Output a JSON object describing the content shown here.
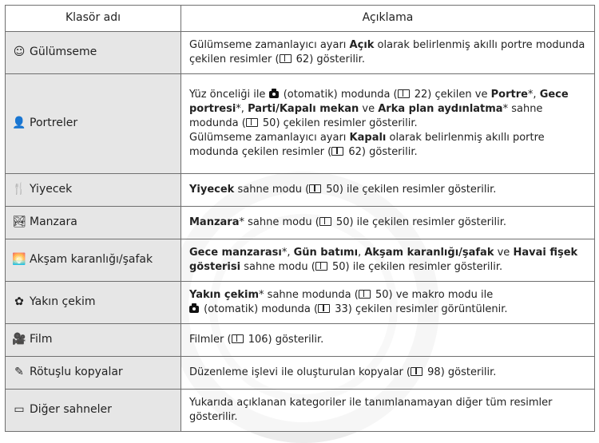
{
  "header": {
    "col_name": "Klasör adı",
    "col_desc": "Açıklama"
  },
  "rows": [
    {
      "icon": "smile-timer-icon",
      "glyph": "☺",
      "name": "Gülümseme",
      "parts": [
        {
          "t": "Gülümseme zamanlayıcı ayarı "
        },
        {
          "t": "Açık",
          "b": true
        },
        {
          "t": " olarak belirlenmiş akıllı portre modunda çekilen resimler ("
        },
        {
          "ref": "book"
        },
        {
          "t": " 62) gösterilir."
        }
      ]
    },
    {
      "icon": "portrait-icon",
      "glyph": "👤",
      "name": "Portreler",
      "parts": [
        {
          "t": "Yüz önceliği ile "
        },
        {
          "ref": "camera"
        },
        {
          "t": " (otomatik) modunda ("
        },
        {
          "ref": "book"
        },
        {
          "t": " 22) çekilen ve "
        },
        {
          "t": "Portre",
          "b": true
        },
        {
          "t": "*, "
        },
        {
          "t": "Gece portresi",
          "b": true
        },
        {
          "t": "*, "
        },
        {
          "t": "Parti/Kapalı mekan",
          "b": true
        },
        {
          "t": " ve "
        },
        {
          "t": "Arka plan aydınlatma",
          "b": true
        },
        {
          "t": "* sahne modunda ("
        },
        {
          "ref": "book"
        },
        {
          "t": " 50) çekilen resimler gösterilir."
        },
        {
          "br": true
        },
        {
          "t": "Gülümseme zamanlayıcı ayarı "
        },
        {
          "t": "Kapalı",
          "b": true
        },
        {
          "t": " olarak belirlenmiş akıllı portre modunda çekilen resimler ("
        },
        {
          "ref": "book"
        },
        {
          "t": " 62) gösterilir."
        }
      ]
    },
    {
      "icon": "food-icon",
      "glyph": "🍴",
      "name": "Yiyecek",
      "parts": [
        {
          "t": "Yiyecek",
          "b": true
        },
        {
          "t": " sahne modu ("
        },
        {
          "ref": "book"
        },
        {
          "t": " 50) ile çekilen resimler gösterilir."
        }
      ]
    },
    {
      "icon": "landscape-icon",
      "glyph": "🏞",
      "name": "Manzara",
      "parts": [
        {
          "t": "Manzara",
          "b": true
        },
        {
          "t": "* sahne modu ("
        },
        {
          "ref": "book"
        },
        {
          "t": " 50) ile çekilen resimler gösterilir."
        }
      ]
    },
    {
      "icon": "dusk-dawn-icon",
      "glyph": "🌅",
      "name": "Akşam karanlığı/şafak",
      "parts": [
        {
          "t": "Gece manzarası",
          "b": true
        },
        {
          "t": "*, "
        },
        {
          "t": "Gün batımı",
          "b": true
        },
        {
          "t": ", "
        },
        {
          "t": "Akşam karanlığı/şafak",
          "b": true
        },
        {
          "t": " ve "
        },
        {
          "t": "Havai fişek gösterisi",
          "b": true
        },
        {
          "t": " sahne modu ("
        },
        {
          "ref": "book"
        },
        {
          "t": " 50) ile çekilen resimler gösterilir."
        }
      ]
    },
    {
      "icon": "close-up-icon",
      "glyph": "✿",
      "name": "Yakın çekim",
      "parts": [
        {
          "t": "Yakın çekim",
          "b": true
        },
        {
          "t": "* sahne modunda ("
        },
        {
          "ref": "book"
        },
        {
          "t": " 50) ve makro modu ile "
        },
        {
          "br": true
        },
        {
          "ref": "camera"
        },
        {
          "t": " (otomatik) modunda ("
        },
        {
          "ref": "book"
        },
        {
          "t": " 33) çekilen resimler görüntülenir."
        }
      ]
    },
    {
      "icon": "movie-icon",
      "glyph": "🎥",
      "name": "Film",
      "parts": [
        {
          "t": "Filmler ("
        },
        {
          "ref": "book"
        },
        {
          "t": " 106) gösterilir."
        }
      ]
    },
    {
      "icon": "retouch-icon",
      "glyph": "✎",
      "name": "Rötuşlu kopyalar",
      "parts": [
        {
          "t": "Düzenleme işlevi ile oluşturulan kopyalar ("
        },
        {
          "ref": "book"
        },
        {
          "t": " 98) gösterilir."
        }
      ]
    },
    {
      "icon": "other-scenes-icon",
      "glyph": "▭",
      "name": "Diğer sahneler",
      "parts": [
        {
          "t": "Yukarıda açıklanan kategoriler ile tanımlanamayan diğer tüm resimler gösterilir."
        }
      ]
    }
  ]
}
